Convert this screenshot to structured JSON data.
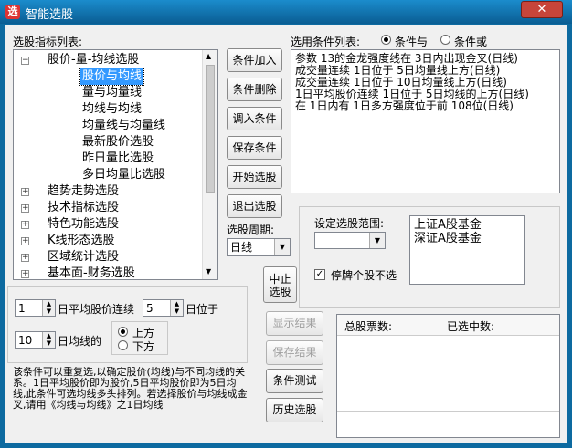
{
  "window": {
    "title": "智能选股",
    "close_glyph": "✕",
    "app_icon": "stock-app-icon"
  },
  "indicator_panel": {
    "label": "选股指标列表:",
    "tree": [
      {
        "label": "股价-量-均线选股",
        "expanded": true
      },
      {
        "label": "股价与均线",
        "selected": true
      },
      {
        "label": "量与均量线"
      },
      {
        "label": "均线与均线"
      },
      {
        "label": "均量线与均量线"
      },
      {
        "label": "最新股价选股"
      },
      {
        "label": "昨日量比选股"
      },
      {
        "label": "多日均量比选股"
      },
      {
        "label": "趋势走势选股"
      },
      {
        "label": "技术指标选股"
      },
      {
        "label": "特色功能选股"
      },
      {
        "label": "K线形态选股"
      },
      {
        "label": "区域统计选股"
      },
      {
        "label": "基本面-财务选股"
      }
    ]
  },
  "buttons": {
    "add": "条件加入",
    "delete": "条件删除",
    "load": "调入条件",
    "save": "保存条件",
    "start": "开始选股",
    "exit": "退出选股",
    "stop_line1": "中止",
    "stop_line2": "选股",
    "show_results": "显示结果",
    "save_results": "保存结果",
    "test": "条件测试",
    "history": "历史选股"
  },
  "conditions": {
    "label": "选用条件列表:",
    "radio_and": "条件与",
    "radio_or": "条件或",
    "logic": "and",
    "items": [
      "参数 13的金龙强度线在 3日内出现金叉(日线)",
      "成交量连续 1日位于 5日均量线上方(日线)",
      "成交量连续 1日位于 10日均量线上方(日线)",
      " 1日平均股价连续 1日位于 5日均线的上方(日线)",
      "在 1日内有 1日多方强度位于前 108位(日线)"
    ]
  },
  "period": {
    "label": "选股周期:",
    "value": "日线"
  },
  "range": {
    "label": "设定选股范围:",
    "dropdown_value": "",
    "list": [
      "上证A股基金",
      "深证A股基金"
    ],
    "suspend_checkbox": "停牌个股不选",
    "suspend_checked": true
  },
  "params": {
    "days_value": "1",
    "avg_label": "日平均股价连续",
    "cont_value": "5",
    "pos_label": "日位于",
    "ma_value": "10",
    "ma_label": "日均线的",
    "above": "上方",
    "below": "下方",
    "selected": "above"
  },
  "description": "该条件可以重复选,以确定股价(均线)与不同均线的关系。1日平均股价即为股价,5日平均股价即为5日均线,此条件可选均线多头排列。若选择股价与均线成金叉,请用《均线与均线》之1日均线",
  "stats": {
    "total_label": "总股票数:",
    "selected_label": "已选中数:"
  },
  "colors": {
    "titlebar": "#0a5d93",
    "selection": "#3399ff",
    "close": "#c7453a"
  }
}
